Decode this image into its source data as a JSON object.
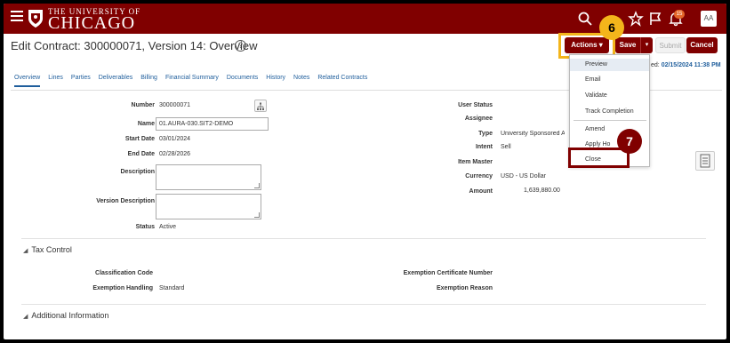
{
  "header": {
    "logo_small": "THE UNIVERSITY OF",
    "logo_main": "CHICAGO",
    "notification_count": "15",
    "avatar_initials": "AA"
  },
  "page": {
    "title": "Edit Contract: 300000071, Version 14: Overview",
    "help_glyph": "?",
    "last_saved_label": "ed:",
    "last_saved_value": "02/15/2024 11:38 PM"
  },
  "buttons": {
    "actions": "Actions ▾",
    "save": "Save",
    "save_dd": "▾",
    "submit": "Submit",
    "cancel": "Cancel"
  },
  "steps": {
    "six": "6",
    "seven": "7"
  },
  "tabs": [
    "Overview",
    "Lines",
    "Parties",
    "Deliverables",
    "Billing",
    "Financial Summary",
    "Documents",
    "History",
    "Notes",
    "Related Contracts"
  ],
  "form": {
    "number_label": "Number",
    "number_value": "300000071",
    "name_label": "Name",
    "name_value": "01.AURA-030.SIT2-DEMO",
    "start_label": "Start Date",
    "start_value": "03/01/2024",
    "end_label": "End Date",
    "end_value": "02/28/2026",
    "desc_label": "Description",
    "version_desc_label": "Version Description",
    "status_label": "Status",
    "status_value": "Active"
  },
  "right_form": {
    "user_status_label": "User Status",
    "assignee_label": "Assignee",
    "type_label": "Type",
    "type_value": "University Sponsored Au",
    "intent_label": "Intent",
    "intent_value": "Sell",
    "item_master_label": "Item Master",
    "currency_label": "Currency",
    "currency_value": "USD - US Dollar",
    "amount_label": "Amount",
    "amount_value": "1,639,880.00"
  },
  "tax": {
    "section_title": "Tax Control",
    "class_code_label": "Classification Code",
    "exemption_handling_label": "Exemption Handling",
    "exemption_handling_value": "Standard",
    "exemption_cert_label": "Exemption Certificate Number",
    "exemption_reason_label": "Exemption Reason"
  },
  "additional": {
    "section_title": "Additional Information"
  },
  "dropdown": {
    "preview": "Preview",
    "email": "Email",
    "validate": "Validate",
    "track": "Track Completion",
    "amend": "Amend",
    "apply_hold": "Apply Ho",
    "close": "Close"
  },
  "colors": {
    "brand": "#800000",
    "highlight": "#f3b51b",
    "link": "#1f5e9c"
  }
}
